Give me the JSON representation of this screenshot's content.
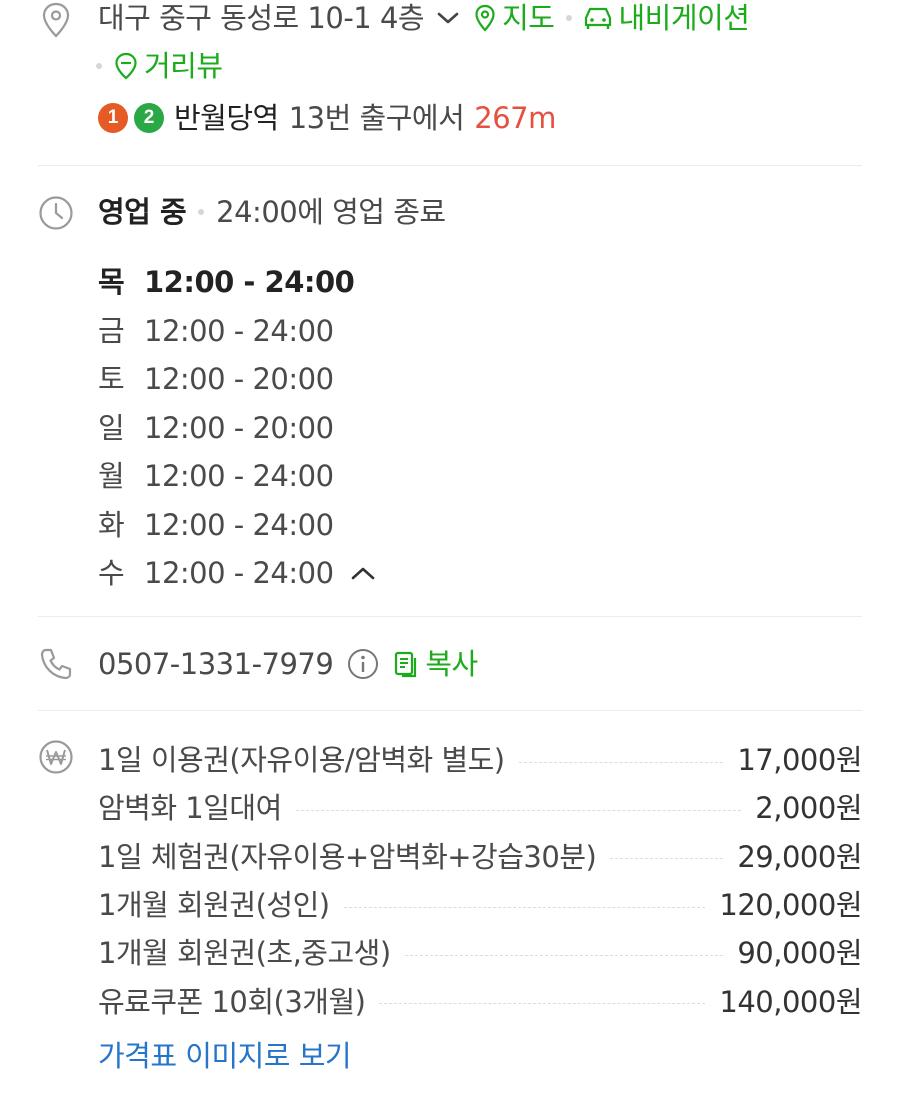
{
  "address": {
    "text": "대구 중구 동성로 10-1 4층",
    "map_label": "지도",
    "navigation_label": "내비게이션",
    "streetview_label": "거리뷰",
    "subway": {
      "line1": "1",
      "line2": "2",
      "station": "반월당역",
      "exit_text": "13번 출구에서",
      "distance": "267m"
    }
  },
  "hours": {
    "status": "영업 중",
    "close_info": "24:00에 영업 종료",
    "days": [
      {
        "day": "목",
        "time": "12:00 - 24:00"
      },
      {
        "day": "금",
        "time": "12:00 - 24:00"
      },
      {
        "day": "토",
        "time": "12:00 - 20:00"
      },
      {
        "day": "일",
        "time": "12:00 - 20:00"
      },
      {
        "day": "월",
        "time": "12:00 - 24:00"
      },
      {
        "day": "화",
        "time": "12:00 - 24:00"
      },
      {
        "day": "수",
        "time": "12:00 - 24:00"
      }
    ]
  },
  "phone": {
    "number": "0507-1331-7979",
    "copy_label": "복사"
  },
  "prices": {
    "items": [
      {
        "name": "1일 이용권(자유이용/암벽화 별도)",
        "price": "17,000원"
      },
      {
        "name": "암벽화 1일대여",
        "price": "2,000원"
      },
      {
        "name": "1일 체험권(자유이용+암벽화+강습30분)",
        "price": "29,000원"
      },
      {
        "name": "1개월 회원권(성인)",
        "price": "120,000원"
      },
      {
        "name": "1개월 회원권(초,중고생)",
        "price": "90,000원"
      },
      {
        "name": "유료쿠폰 10회(3개월)",
        "price": "140,000원"
      }
    ],
    "more_link": "가격표 이미지로 보기"
  },
  "colors": {
    "green": "#1bab1b",
    "red": "#e5503f",
    "blue": "#2575c8",
    "line1": "#e55a25",
    "line2": "#2aa845"
  },
  "icons": [
    "location-pin-icon",
    "chevron-down-icon",
    "map-pin-icon",
    "car-icon",
    "streetview-icon",
    "clock-icon",
    "chevron-up-icon",
    "phone-icon",
    "info-icon",
    "copy-icon",
    "won-icon"
  ]
}
